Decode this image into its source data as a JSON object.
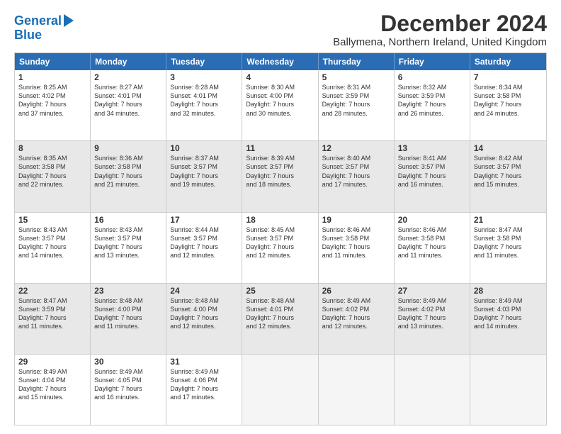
{
  "logo": {
    "line1": "General",
    "line2": "Blue"
  },
  "title": "December 2024",
  "subtitle": "Ballymena, Northern Ireland, United Kingdom",
  "headers": [
    "Sunday",
    "Monday",
    "Tuesday",
    "Wednesday",
    "Thursday",
    "Friday",
    "Saturday"
  ],
  "weeks": [
    [
      {
        "num": "1",
        "lines": [
          "Sunrise: 8:25 AM",
          "Sunset: 4:02 PM",
          "Daylight: 7 hours",
          "and 37 minutes."
        ],
        "shaded": false,
        "empty": false
      },
      {
        "num": "2",
        "lines": [
          "Sunrise: 8:27 AM",
          "Sunset: 4:01 PM",
          "Daylight: 7 hours",
          "and 34 minutes."
        ],
        "shaded": false,
        "empty": false
      },
      {
        "num": "3",
        "lines": [
          "Sunrise: 8:28 AM",
          "Sunset: 4:01 PM",
          "Daylight: 7 hours",
          "and 32 minutes."
        ],
        "shaded": false,
        "empty": false
      },
      {
        "num": "4",
        "lines": [
          "Sunrise: 8:30 AM",
          "Sunset: 4:00 PM",
          "Daylight: 7 hours",
          "and 30 minutes."
        ],
        "shaded": false,
        "empty": false
      },
      {
        "num": "5",
        "lines": [
          "Sunrise: 8:31 AM",
          "Sunset: 3:59 PM",
          "Daylight: 7 hours",
          "and 28 minutes."
        ],
        "shaded": false,
        "empty": false
      },
      {
        "num": "6",
        "lines": [
          "Sunrise: 8:32 AM",
          "Sunset: 3:59 PM",
          "Daylight: 7 hours",
          "and 26 minutes."
        ],
        "shaded": false,
        "empty": false
      },
      {
        "num": "7",
        "lines": [
          "Sunrise: 8:34 AM",
          "Sunset: 3:58 PM",
          "Daylight: 7 hours",
          "and 24 minutes."
        ],
        "shaded": false,
        "empty": false
      }
    ],
    [
      {
        "num": "8",
        "lines": [
          "Sunrise: 8:35 AM",
          "Sunset: 3:58 PM",
          "Daylight: 7 hours",
          "and 22 minutes."
        ],
        "shaded": true,
        "empty": false
      },
      {
        "num": "9",
        "lines": [
          "Sunrise: 8:36 AM",
          "Sunset: 3:58 PM",
          "Daylight: 7 hours",
          "and 21 minutes."
        ],
        "shaded": true,
        "empty": false
      },
      {
        "num": "10",
        "lines": [
          "Sunrise: 8:37 AM",
          "Sunset: 3:57 PM",
          "Daylight: 7 hours",
          "and 19 minutes."
        ],
        "shaded": true,
        "empty": false
      },
      {
        "num": "11",
        "lines": [
          "Sunrise: 8:39 AM",
          "Sunset: 3:57 PM",
          "Daylight: 7 hours",
          "and 18 minutes."
        ],
        "shaded": true,
        "empty": false
      },
      {
        "num": "12",
        "lines": [
          "Sunrise: 8:40 AM",
          "Sunset: 3:57 PM",
          "Daylight: 7 hours",
          "and 17 minutes."
        ],
        "shaded": true,
        "empty": false
      },
      {
        "num": "13",
        "lines": [
          "Sunrise: 8:41 AM",
          "Sunset: 3:57 PM",
          "Daylight: 7 hours",
          "and 16 minutes."
        ],
        "shaded": true,
        "empty": false
      },
      {
        "num": "14",
        "lines": [
          "Sunrise: 8:42 AM",
          "Sunset: 3:57 PM",
          "Daylight: 7 hours",
          "and 15 minutes."
        ],
        "shaded": true,
        "empty": false
      }
    ],
    [
      {
        "num": "15",
        "lines": [
          "Sunrise: 8:43 AM",
          "Sunset: 3:57 PM",
          "Daylight: 7 hours",
          "and 14 minutes."
        ],
        "shaded": false,
        "empty": false
      },
      {
        "num": "16",
        "lines": [
          "Sunrise: 8:43 AM",
          "Sunset: 3:57 PM",
          "Daylight: 7 hours",
          "and 13 minutes."
        ],
        "shaded": false,
        "empty": false
      },
      {
        "num": "17",
        "lines": [
          "Sunrise: 8:44 AM",
          "Sunset: 3:57 PM",
          "Daylight: 7 hours",
          "and 12 minutes."
        ],
        "shaded": false,
        "empty": false
      },
      {
        "num": "18",
        "lines": [
          "Sunrise: 8:45 AM",
          "Sunset: 3:57 PM",
          "Daylight: 7 hours",
          "and 12 minutes."
        ],
        "shaded": false,
        "empty": false
      },
      {
        "num": "19",
        "lines": [
          "Sunrise: 8:46 AM",
          "Sunset: 3:58 PM",
          "Daylight: 7 hours",
          "and 11 minutes."
        ],
        "shaded": false,
        "empty": false
      },
      {
        "num": "20",
        "lines": [
          "Sunrise: 8:46 AM",
          "Sunset: 3:58 PM",
          "Daylight: 7 hours",
          "and 11 minutes."
        ],
        "shaded": false,
        "empty": false
      },
      {
        "num": "21",
        "lines": [
          "Sunrise: 8:47 AM",
          "Sunset: 3:58 PM",
          "Daylight: 7 hours",
          "and 11 minutes."
        ],
        "shaded": false,
        "empty": false
      }
    ],
    [
      {
        "num": "22",
        "lines": [
          "Sunrise: 8:47 AM",
          "Sunset: 3:59 PM",
          "Daylight: 7 hours",
          "and 11 minutes."
        ],
        "shaded": true,
        "empty": false
      },
      {
        "num": "23",
        "lines": [
          "Sunrise: 8:48 AM",
          "Sunset: 4:00 PM",
          "Daylight: 7 hours",
          "and 11 minutes."
        ],
        "shaded": true,
        "empty": false
      },
      {
        "num": "24",
        "lines": [
          "Sunrise: 8:48 AM",
          "Sunset: 4:00 PM",
          "Daylight: 7 hours",
          "and 12 minutes."
        ],
        "shaded": true,
        "empty": false
      },
      {
        "num": "25",
        "lines": [
          "Sunrise: 8:48 AM",
          "Sunset: 4:01 PM",
          "Daylight: 7 hours",
          "and 12 minutes."
        ],
        "shaded": true,
        "empty": false
      },
      {
        "num": "26",
        "lines": [
          "Sunrise: 8:49 AM",
          "Sunset: 4:02 PM",
          "Daylight: 7 hours",
          "and 12 minutes."
        ],
        "shaded": true,
        "empty": false
      },
      {
        "num": "27",
        "lines": [
          "Sunrise: 8:49 AM",
          "Sunset: 4:02 PM",
          "Daylight: 7 hours",
          "and 13 minutes."
        ],
        "shaded": true,
        "empty": false
      },
      {
        "num": "28",
        "lines": [
          "Sunrise: 8:49 AM",
          "Sunset: 4:03 PM",
          "Daylight: 7 hours",
          "and 14 minutes."
        ],
        "shaded": true,
        "empty": false
      }
    ],
    [
      {
        "num": "29",
        "lines": [
          "Sunrise: 8:49 AM",
          "Sunset: 4:04 PM",
          "Daylight: 7 hours",
          "and 15 minutes."
        ],
        "shaded": false,
        "empty": false
      },
      {
        "num": "30",
        "lines": [
          "Sunrise: 8:49 AM",
          "Sunset: 4:05 PM",
          "Daylight: 7 hours",
          "and 16 minutes."
        ],
        "shaded": false,
        "empty": false
      },
      {
        "num": "31",
        "lines": [
          "Sunrise: 8:49 AM",
          "Sunset: 4:06 PM",
          "Daylight: 7 hours",
          "and 17 minutes."
        ],
        "shaded": false,
        "empty": false
      },
      {
        "num": "",
        "lines": [],
        "shaded": false,
        "empty": true
      },
      {
        "num": "",
        "lines": [],
        "shaded": false,
        "empty": true
      },
      {
        "num": "",
        "lines": [],
        "shaded": false,
        "empty": true
      },
      {
        "num": "",
        "lines": [],
        "shaded": false,
        "empty": true
      }
    ]
  ]
}
